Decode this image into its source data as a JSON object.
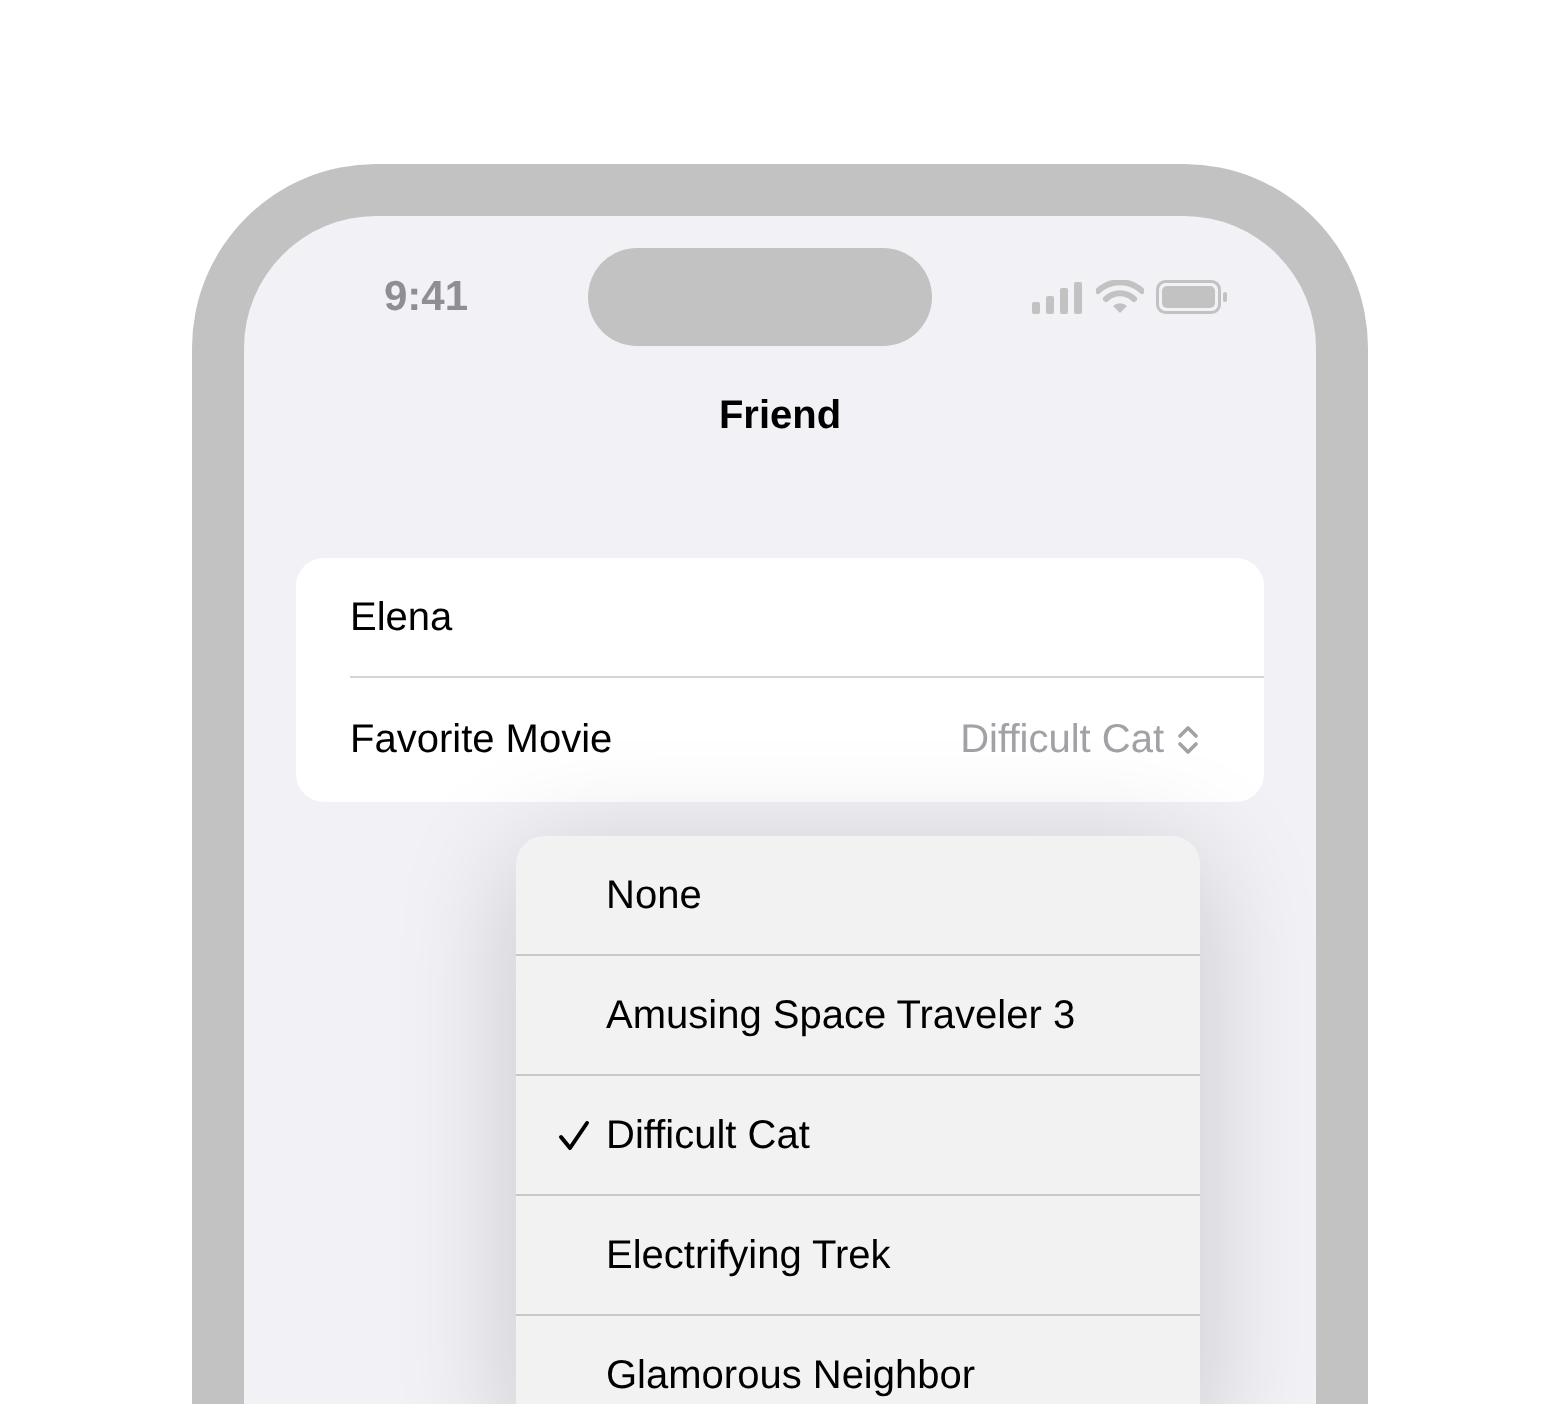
{
  "status_bar": {
    "time": "9:41"
  },
  "nav": {
    "title": "Friend"
  },
  "form": {
    "name": {
      "value": "Elena"
    },
    "picker": {
      "label": "Favorite Movie",
      "value": "Difficult Cat"
    }
  },
  "menu": {
    "items": [
      {
        "label": "None",
        "selected": false
      },
      {
        "label": "Amusing Space Traveler 3",
        "selected": false
      },
      {
        "label": "Difficult Cat",
        "selected": true
      },
      {
        "label": "Electrifying Trek",
        "selected": false
      },
      {
        "label": "Glamorous Neighbor",
        "selected": false
      }
    ]
  }
}
